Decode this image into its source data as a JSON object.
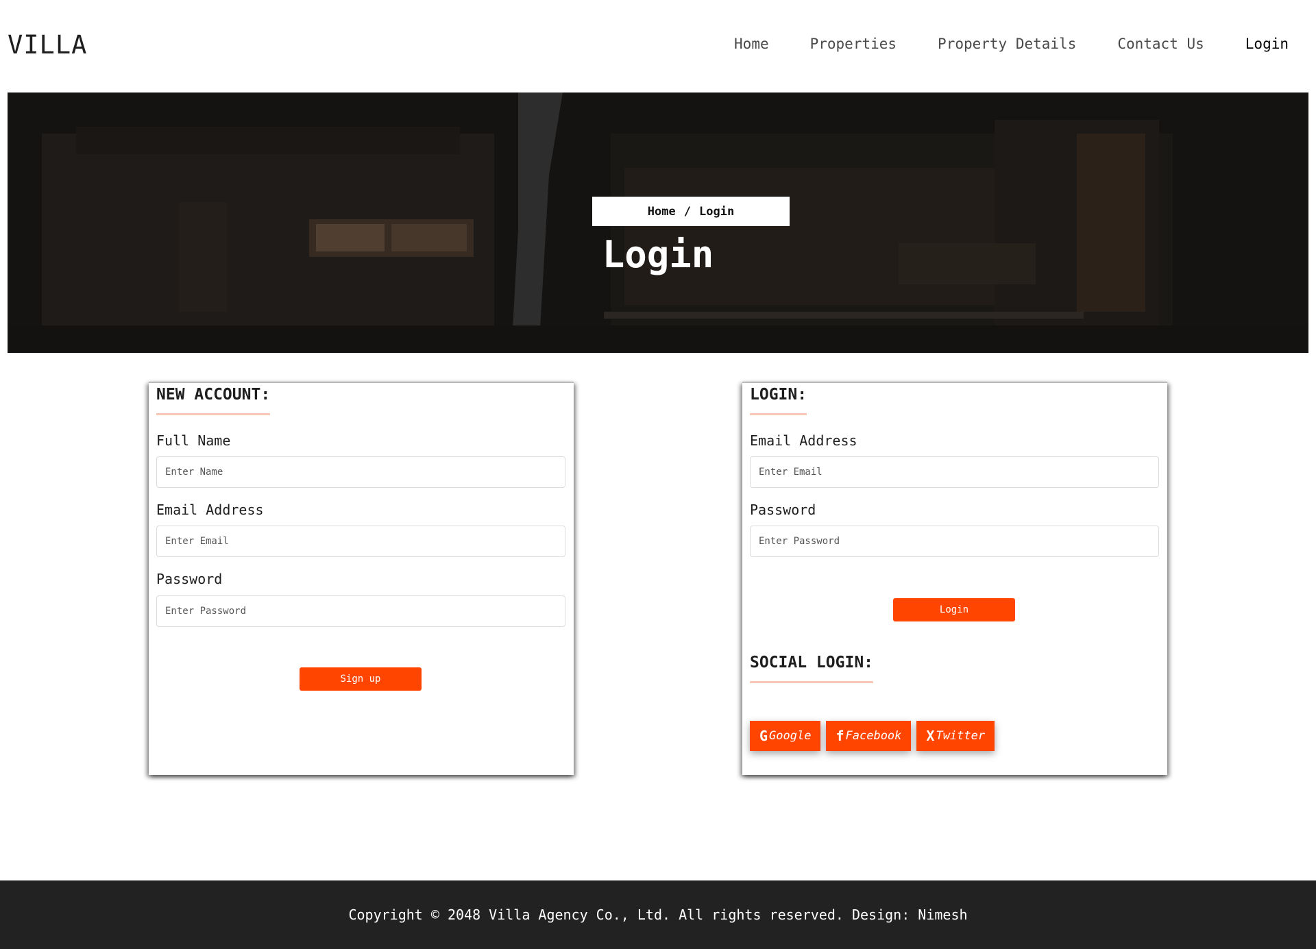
{
  "brand": "VILLA",
  "nav": {
    "items": [
      {
        "label": "Home"
      },
      {
        "label": "Properties"
      },
      {
        "label": "Property Details"
      },
      {
        "label": "Contact Us"
      },
      {
        "label": "Login"
      }
    ]
  },
  "hero": {
    "breadcrumb": {
      "home": "Home",
      "sep": "/",
      "current": "Login"
    },
    "title": "Login"
  },
  "signup": {
    "heading": "NEW ACCOUNT:",
    "name_label": "Full Name",
    "name_placeholder": "Enter Name",
    "email_label": "Email Address",
    "email_placeholder": "Enter Email",
    "password_label": "Password",
    "password_placeholder": "Enter Password",
    "submit": "Sign up"
  },
  "login": {
    "heading": "LOGIN:",
    "email_label": "Email Address",
    "email_placeholder": "Enter Email",
    "password_label": "Password",
    "password_placeholder": "Enter Password",
    "submit": "Login",
    "social_heading": "SOCIAL LOGIN:",
    "social": [
      {
        "icon": "G",
        "label": "Google"
      },
      {
        "icon": "f",
        "label": "Facebook"
      },
      {
        "icon": "X",
        "label": "Twitter"
      }
    ]
  },
  "footer": {
    "text": "Copyright © 2048 Villa Agency Co., Ltd. All rights reserved. Design: Nimesh"
  },
  "colors": {
    "accent": "#ff4500",
    "footer_bg": "#222222",
    "underline": "#f9c7b5"
  }
}
